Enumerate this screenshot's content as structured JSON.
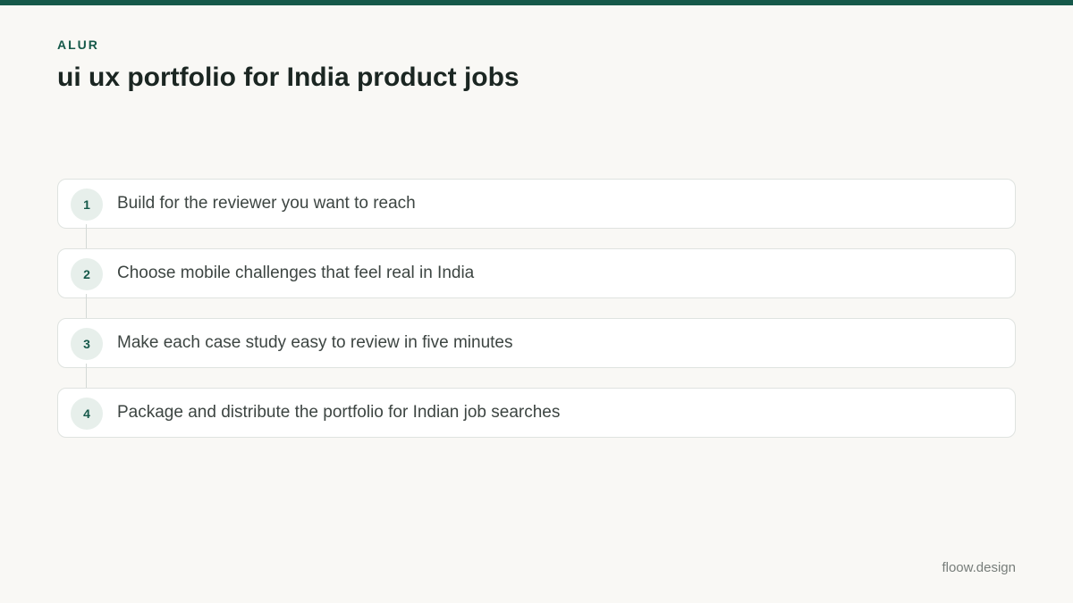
{
  "header": {
    "eyebrow": "ALUR",
    "title": "ui ux portfolio for India product jobs"
  },
  "steps": [
    {
      "number": "1",
      "label": "Build for the reviewer you want to reach"
    },
    {
      "number": "2",
      "label": "Choose mobile challenges that feel real in India"
    },
    {
      "number": "3",
      "label": "Make each case study easy to review in five minutes"
    },
    {
      "number": "4",
      "label": "Package and distribute the portfolio for Indian job searches"
    }
  ],
  "footer": {
    "brand": "floow.design"
  },
  "colors": {
    "accent": "#16594a",
    "background": "#f9f8f5",
    "badge_bg": "#e7efeb",
    "card_border": "#dfe3e0"
  }
}
